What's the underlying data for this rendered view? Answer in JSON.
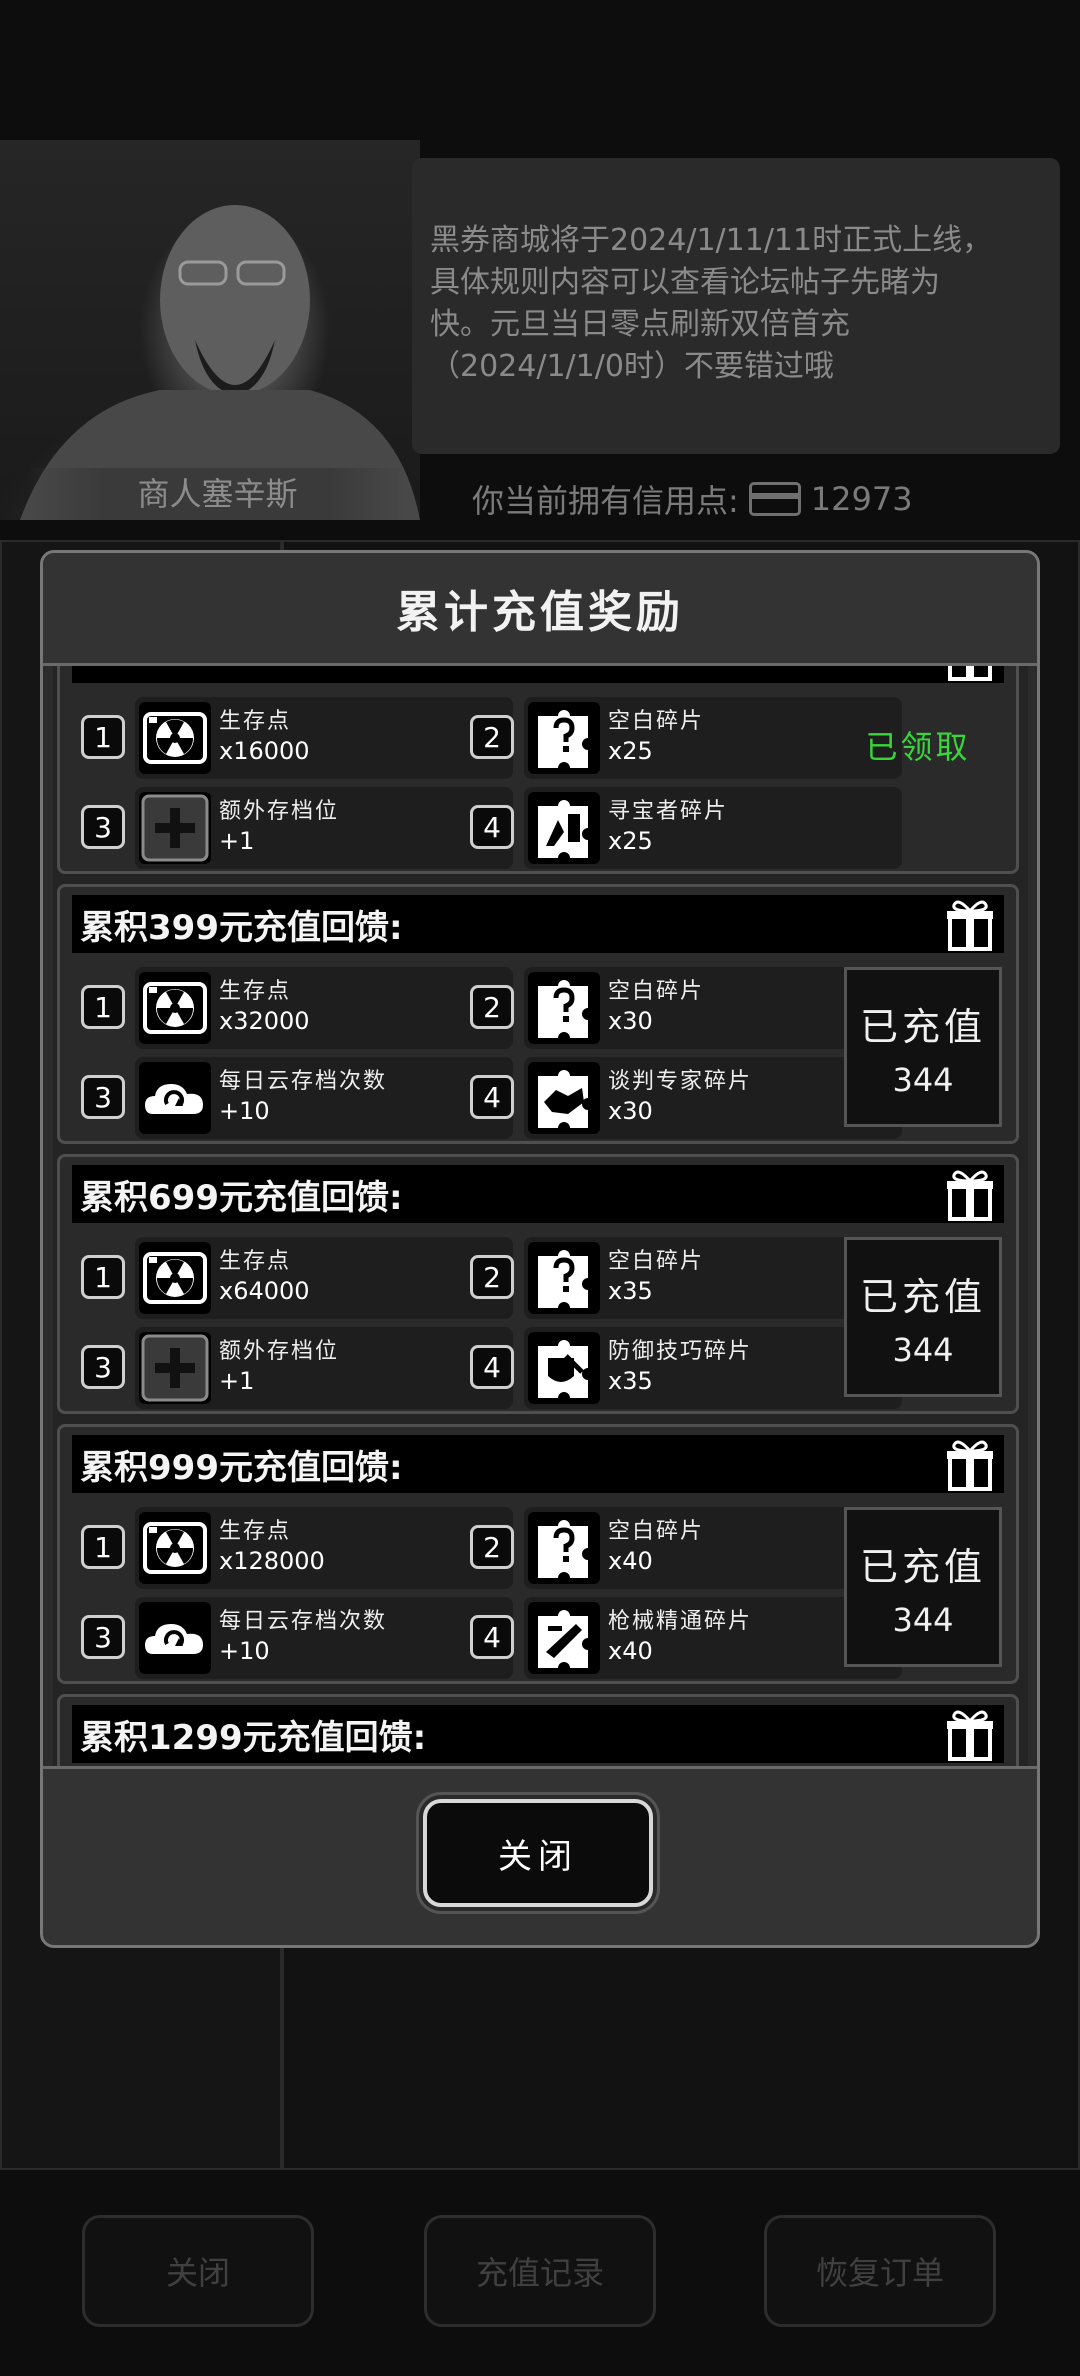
{
  "background": {
    "merchant_name": "商人塞辛斯",
    "notice_lines": [
      "黑券商城将于2024/1/11/11时正式上线，",
      "具体规则内容可以查看论坛帖子先睹为",
      "快。元旦当日零点刷新双倍首充",
      "（2024/1/1/0时）不要错过哦"
    ],
    "credit_label": "你当前拥有信用点:",
    "credit_value": "12973",
    "buttons": [
      "关闭",
      "充值记录",
      "恢复订单"
    ]
  },
  "modal": {
    "title": "累计充值奖励",
    "close_label": "关闭",
    "tiers": [
      {
        "title": "",
        "status": "claimed",
        "status_text": "已领取",
        "rewards": [
          {
            "index": "1",
            "name": "生存点",
            "qty": "x16000",
            "icon": "radiation-icon"
          },
          {
            "index": "2",
            "name": "空白碎片",
            "qty": "x25",
            "icon": "puzzle-question-icon"
          },
          {
            "index": "3",
            "name": "额外存档位",
            "qty": "+1",
            "icon": "plus-slot-icon"
          },
          {
            "index": "4",
            "name": "寻宝者碎片",
            "qty": "x25",
            "icon": "puzzle-treasure-icon"
          }
        ]
      },
      {
        "title": "累积399元充值回馈:",
        "status": "charged",
        "status_label": "已充值",
        "status_value": "344",
        "rewards": [
          {
            "index": "1",
            "name": "生存点",
            "qty": "x32000",
            "icon": "radiation-icon"
          },
          {
            "index": "2",
            "name": "空白碎片",
            "qty": "x30",
            "icon": "puzzle-question-icon"
          },
          {
            "index": "3",
            "name": "每日云存档次数",
            "qty": "+10",
            "icon": "cloud-sync-icon"
          },
          {
            "index": "4",
            "name": "谈判专家碎片",
            "qty": "x30",
            "icon": "puzzle-handshake-icon"
          }
        ]
      },
      {
        "title": "累积699元充值回馈:",
        "status": "charged",
        "status_label": "已充值",
        "status_value": "344",
        "rewards": [
          {
            "index": "1",
            "name": "生存点",
            "qty": "x64000",
            "icon": "radiation-icon"
          },
          {
            "index": "2",
            "name": "空白碎片",
            "qty": "x35",
            "icon": "puzzle-question-icon"
          },
          {
            "index": "3",
            "name": "额外存档位",
            "qty": "+1",
            "icon": "plus-slot-icon"
          },
          {
            "index": "4",
            "name": "防御技巧碎片",
            "qty": "x35",
            "icon": "puzzle-shield-icon"
          }
        ]
      },
      {
        "title": "累积999元充值回馈:",
        "status": "charged",
        "status_label": "已充值",
        "status_value": "344",
        "rewards": [
          {
            "index": "1",
            "name": "生存点",
            "qty": "x128000",
            "icon": "radiation-icon"
          },
          {
            "index": "2",
            "name": "空白碎片",
            "qty": "x40",
            "icon": "puzzle-question-icon"
          },
          {
            "index": "3",
            "name": "每日云存档次数",
            "qty": "+10",
            "icon": "cloud-sync-icon"
          },
          {
            "index": "4",
            "name": "枪械精通碎片",
            "qty": "x40",
            "icon": "puzzle-gun-icon"
          }
        ]
      },
      {
        "title": "累积1299元充值回馈:",
        "status": "partial",
        "rewards": []
      }
    ]
  }
}
